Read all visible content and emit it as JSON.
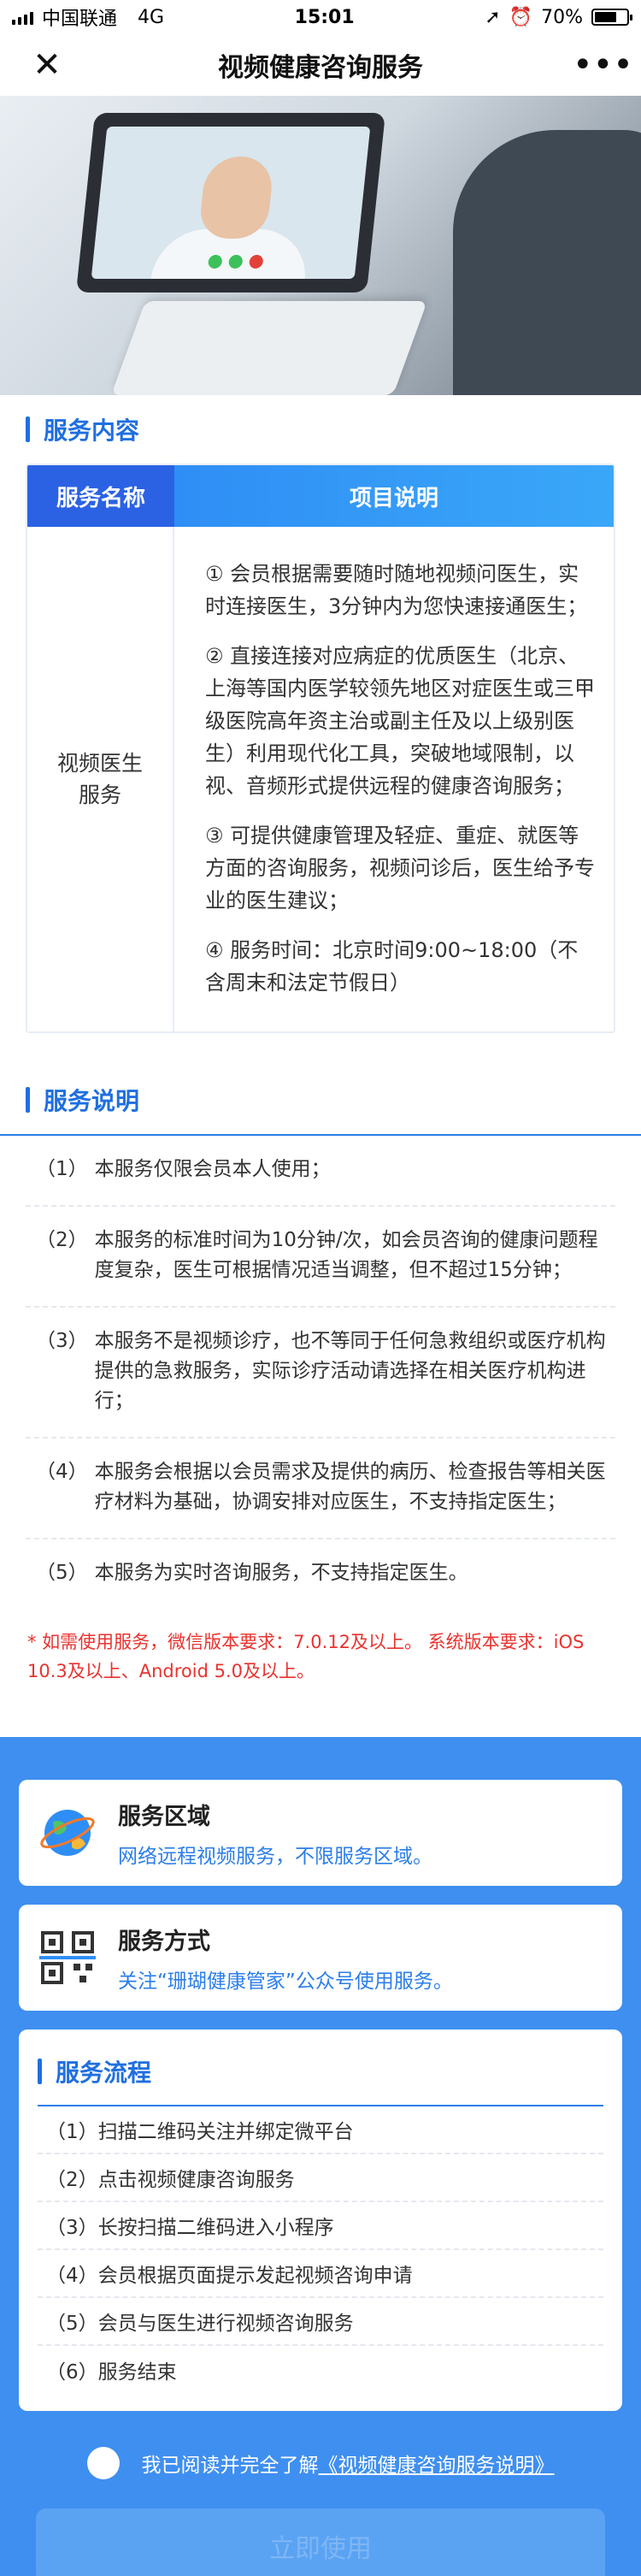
{
  "status_bar": {
    "carrier": "中国联通",
    "network": "4G",
    "time": "15:01",
    "battery": "70%",
    "battery_level": 0.7
  },
  "nav": {
    "title": "视频健康咨询服务"
  },
  "service_content": {
    "title": "服务内容",
    "headers": [
      "服务名称",
      "项目说明"
    ],
    "name": "视频医生服务",
    "items": [
      "① 会员根据需要随时随地视频问医生，实时连接医生，3分钟内为您快速接通医生；",
      "② 直接连接对应病症的优质医生（北京、上海等国内医学较领先地区对症医生或三甲级医院高年资主治或副主任及以上级别医生）利用现代化工具，突破地域限制，以视、音频形式提供远程的健康咨询服务；",
      "③ 可提供健康管理及轻症、重症、就医等方面的咨询服务，视频问诊后，医生给予专业的医生建议；",
      "④ 服务时间：北京时间9:00~18:00（不含周末和法定节假日）"
    ]
  },
  "service_notes": {
    "title": "服务说明",
    "items": [
      {
        "num": "（1）",
        "text": "本服务仅限会员本人使用；"
      },
      {
        "num": "（2）",
        "text": "本服务的标准时间为10分钟/次，如会员咨询的健康问题程度复杂，医生可根据情况适当调整，但不超过15分钟；"
      },
      {
        "num": "（3）",
        "text": "本服务不是视频诊疗，也不等同于任何急救组织或医疗机构提供的急救服务，实际诊疗活动请选择在相关医疗机构进行；"
      },
      {
        "num": "（4）",
        "text": "本服务会根据以会员需求及提供的病历、检查报告等相关医疗材料为基础，协调安排对应医生，不支持指定医生；"
      },
      {
        "num": "（5）",
        "text": "本服务为实时咨询服务，不支持指定医生。"
      }
    ],
    "warning": "* 如需使用服务，微信版本要求：7.0.12及以上。 系统版本要求：iOS 10.3及以上、Android 5.0及以上。"
  },
  "service_area": {
    "title": "服务区域",
    "desc": "网络远程视频服务，不限服务区域。"
  },
  "service_method": {
    "title": "服务方式",
    "desc": "关注“珊瑚健康管家”公众号使用服务。"
  },
  "process": {
    "title": "服务流程",
    "steps": [
      "（1）扫描二维码关注并绑定微平台",
      "（2）点击视频健康咨询服务",
      "（3）长按扫描二维码进入小程序",
      "（4）会员根据页面提示发起视频咨询申请",
      "（5）会员与医生进行视频咨询服务",
      "（6）服务结束"
    ]
  },
  "agreement": {
    "prefix": "我已阅读并完全了解",
    "link": "《视频健康咨询服务说明》"
  },
  "cta": {
    "label": "立即使用"
  },
  "colors": {
    "primary": "#2b7ee9",
    "background_blue": "#3f8ff0",
    "warning": "#e8332f"
  }
}
